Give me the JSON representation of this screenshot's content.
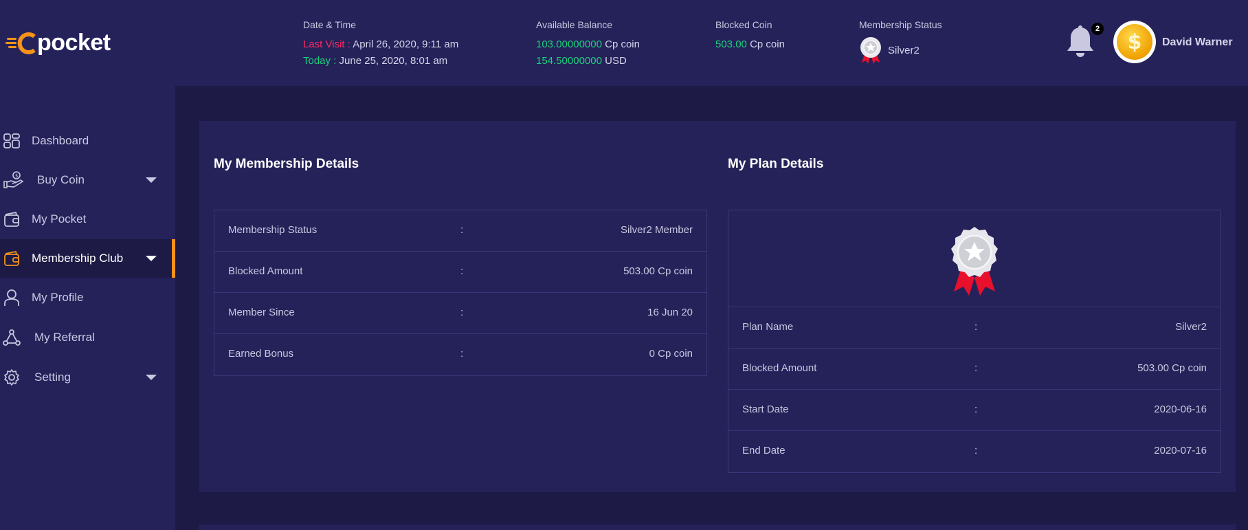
{
  "brand": {
    "name": "pocket"
  },
  "header": {
    "datetime": {
      "label": "Date & Time",
      "last_visit_label": "Last Visit :",
      "last_visit_value": "April 26, 2020, 9:11 am",
      "today_label": "Today :",
      "today_value": "June 25, 2020, 8:01 am"
    },
    "balance": {
      "label": "Available Balance",
      "cp_amount": "103.00000000",
      "cp_unit": "Cp coin",
      "usd_amount": "154.50000000",
      "usd_unit": "USD"
    },
    "blocked": {
      "label": "Blocked Coin",
      "amount": "503.00",
      "unit": "Cp coin"
    },
    "membership": {
      "label": "Membership Status",
      "value": "Silver2",
      "icon": "silver-medal-icon"
    },
    "notifications": {
      "count": "2",
      "icon": "bell-icon"
    },
    "user": {
      "name": "David Warner",
      "avatar_icon": "dollar-coin-icon"
    }
  },
  "sidebar": {
    "items": [
      {
        "label": "Dashboard",
        "icon": "dashboard-icon",
        "has_submenu": false
      },
      {
        "label": "Buy Coin",
        "icon": "hand-coin-icon",
        "has_submenu": true
      },
      {
        "label": "My Pocket",
        "icon": "wallet-icon",
        "has_submenu": false
      },
      {
        "label": "Membership Club",
        "icon": "wallet-icon",
        "has_submenu": true,
        "active": true
      },
      {
        "label": "My Profile",
        "icon": "user-icon",
        "has_submenu": false
      },
      {
        "label": "My Referral",
        "icon": "share-network-icon",
        "has_submenu": false
      },
      {
        "label": "Setting",
        "icon": "gear-icon",
        "has_submenu": true
      }
    ]
  },
  "membership_details": {
    "title": "My Membership Details",
    "rows": [
      {
        "key": "Membership Status",
        "sep": ":",
        "value": "Silver2 Member"
      },
      {
        "key": "Blocked Amount",
        "sep": ":",
        "value": "503.00 Cp coin"
      },
      {
        "key": "Member Since",
        "sep": ":",
        "value": "16 Jun 20"
      },
      {
        "key": "Earned Bonus",
        "sep": ":",
        "value": "0 Cp coin"
      }
    ]
  },
  "plan_details": {
    "title": "My Plan Details",
    "badge_icon": "silver-medal-icon",
    "rows": [
      {
        "key": "Plan Name",
        "sep": ":",
        "value": "Silver2"
      },
      {
        "key": "Blocked Amount",
        "sep": ":",
        "value": "503.00 Cp coin"
      },
      {
        "key": "Start Date",
        "sep": ":",
        "value": "2020-06-16"
      },
      {
        "key": "End Date",
        "sep": ":",
        "value": "2020-07-16"
      }
    ]
  },
  "colors": {
    "background": "#1d1a45",
    "panel": "#25225a",
    "accent": "#f7931a",
    "positive": "#1dd17a",
    "negative": "#ff2a5f"
  }
}
